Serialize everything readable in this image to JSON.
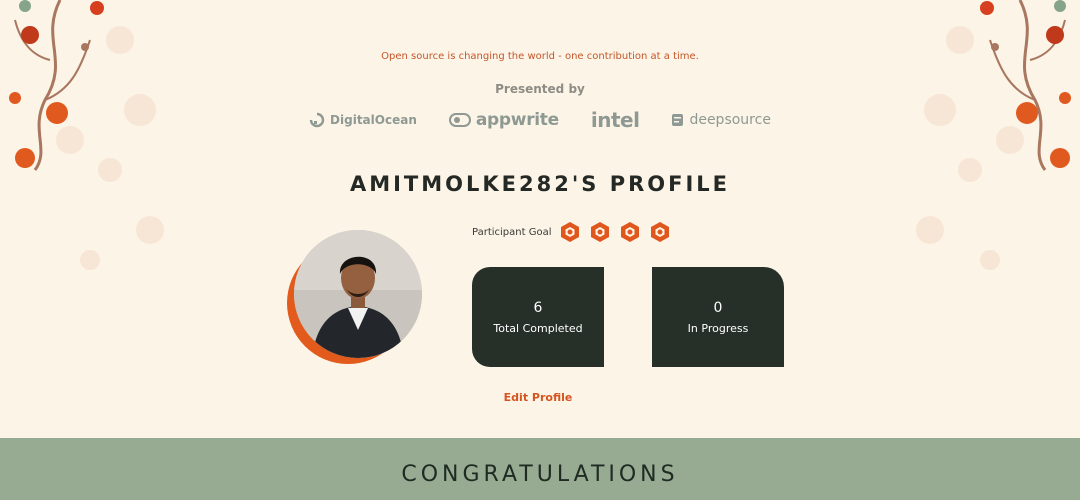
{
  "tagline": "Open source is changing the world - one contribution at a time.",
  "presented_by": "Presented by",
  "sponsors": {
    "digitalocean": "DigitalOcean",
    "appwrite": "appwrite",
    "intel": "intel",
    "deepsource": "deepsource"
  },
  "profile": {
    "title": "AMITMOLKE282'S PROFILE",
    "goal_label": "Participant Goal",
    "goal_badges_earned": 4
  },
  "stats": [
    {
      "value": "6",
      "label": "Total Completed"
    },
    {
      "value": "0",
      "label": "In Progress"
    }
  ],
  "edit_label": "Edit Profile",
  "congrats": "CONGRATULATIONS",
  "colors": {
    "background": "#fcf4e6",
    "accent": "#e25a1c",
    "card": "#263029",
    "band": "#96ab91"
  }
}
